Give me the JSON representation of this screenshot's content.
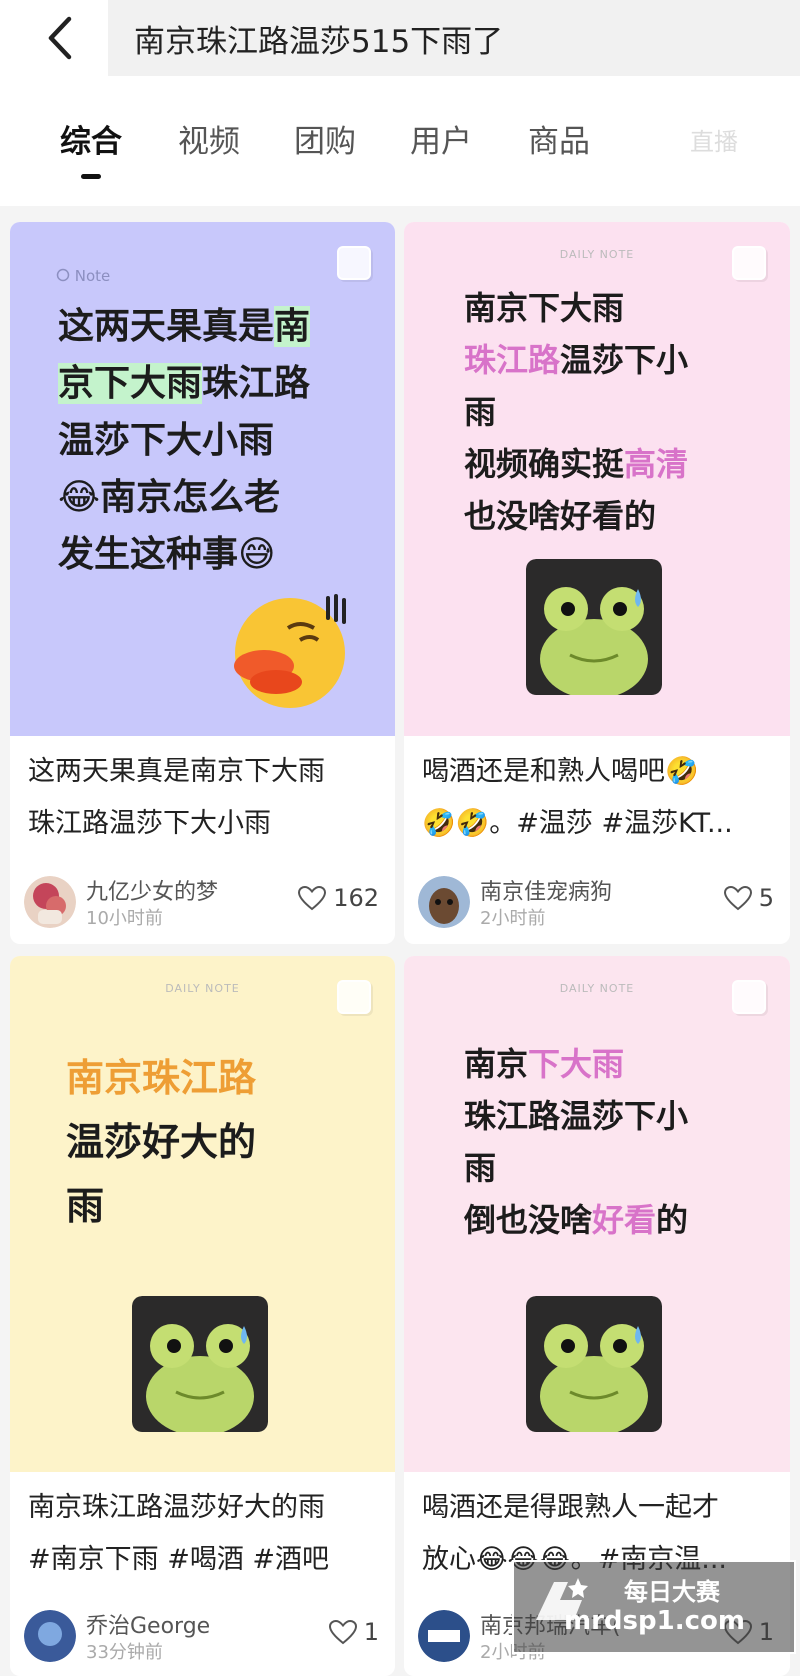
{
  "header": {
    "search_query": "南京珠江路温莎515下雨了"
  },
  "tabs": [
    {
      "label": "综合",
      "active": true
    },
    {
      "label": "视频",
      "active": false
    },
    {
      "label": "团购",
      "active": false
    },
    {
      "label": "用户",
      "active": false
    },
    {
      "label": "商品",
      "active": false
    },
    {
      "label": "直播",
      "active": false
    }
  ],
  "cards": [
    {
      "cover_bg": "#c8c8fb",
      "cover_tag": "Note",
      "cover_lines": [
        "这两天果真是南",
        "京下大雨珠江路",
        "温莎下大小雨",
        "😂南京怎么老",
        "发生这种事😅"
      ],
      "title_lines": [
        "这两天果真是南京下大雨",
        "珠江路温莎下大小雨"
      ],
      "author": "九亿少女的梦",
      "time": "10小时前",
      "likes": "162"
    },
    {
      "cover_bg": "#fce1f0",
      "cover_tag": "DAILY NOTE",
      "cover_lines": [
        "南京下大雨",
        "珠江路温莎下小",
        "雨",
        "视频确实挺高清",
        "也没啥好看的"
      ],
      "title_lines": [
        "喝酒还是和熟人喝吧🤣",
        "🤣🤣。#温莎 #温莎KT..."
      ],
      "author": "南京佳宠病狗",
      "time": "2小时前",
      "likes": "5"
    },
    {
      "cover_bg": "#fdf3c9",
      "cover_tag": "DAILY NOTE",
      "cover_lines": [
        "南京珠江路",
        "温莎好大的",
        "雨"
      ],
      "title_lines": [
        "南京珠江路温莎好大的雨",
        "#南京下雨 #喝酒 #酒吧"
      ],
      "author": "乔治George",
      "time": "33分钟前",
      "likes": "1"
    },
    {
      "cover_bg": "#fce5ef",
      "cover_tag": "DAILY NOTE",
      "cover_lines": [
        "南京下大雨",
        "珠江路温莎下小",
        "雨",
        "倒也没啥好看的"
      ],
      "title_lines": [
        "喝酒还是得跟熟人一起才",
        "放心😂😂😂。#南京温..."
      ],
      "author": "南京邦瑞汽车(",
      "time": "2小时前",
      "likes": "1"
    }
  ],
  "watermark": {
    "sub": "每日大赛",
    "url": "mrdsp1.com"
  },
  "colors": {
    "accent_pink": "#d873c9",
    "accent_orange": "#ee9e35",
    "highlight_green": "#c4f3cc"
  }
}
